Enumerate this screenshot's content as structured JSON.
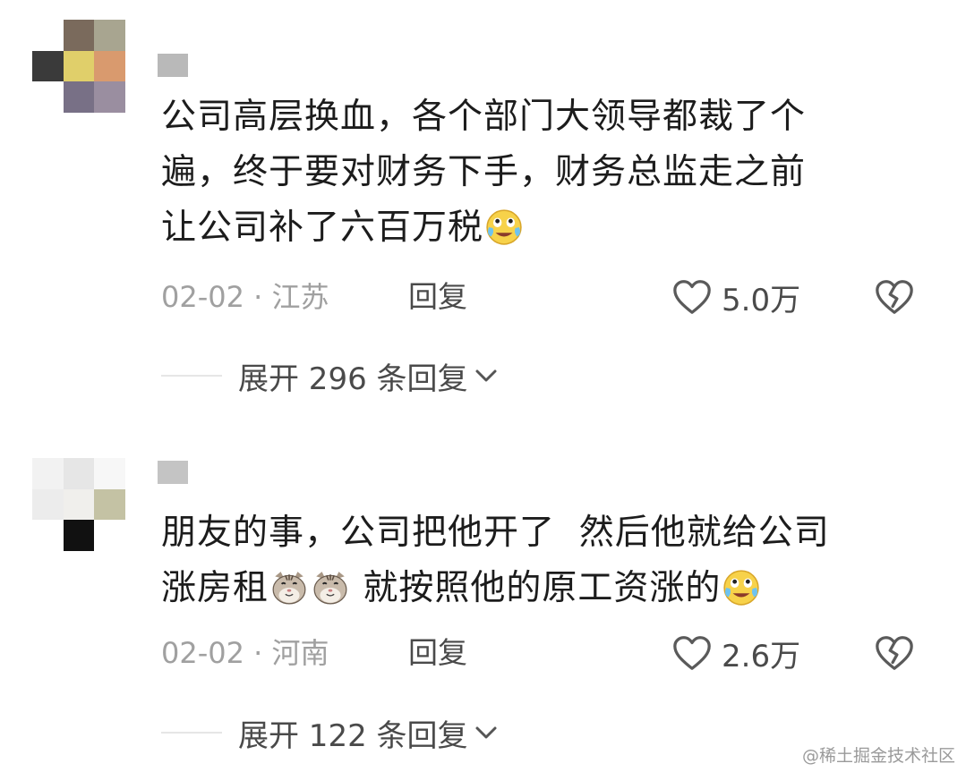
{
  "comments": [
    {
      "text_parts": [
        "公司高层换血，各个部门大领导都裁了个\n遍，终于要对财务下手，财务总监走之前\n让公司补了六百万税"
      ],
      "emojis_after": [
        "crying-laughing-emoji"
      ],
      "date": "02-02",
      "location": "江苏",
      "reply_label": "回复",
      "likes": "5.0万",
      "expand_label": "展开 296 条回复",
      "avatar_colors": [
        "#ffffff",
        "#7a6a5c",
        "#a8a590",
        "#3a3a3a",
        "#e0cf6a",
        "#d99a6e",
        "#ffffff",
        "#787086",
        "#9a8ea0"
      ]
    },
    {
      "line1": "朋友的事，公司把他开了  然后他就给公司",
      "line2_a": "涨房租",
      "line2_b": " 就按照他的原工资涨的",
      "emojis_mid": [
        "cat-face-emoji",
        "cat-face-emoji"
      ],
      "emojis_after": [
        "crying-laughing-emoji"
      ],
      "date": "02-02",
      "location": "河南",
      "reply_label": "回复",
      "likes": "2.6万",
      "expand_label": "展开 122 条回复",
      "avatar_colors": [
        "#f2f2f2",
        "#e6e6e6",
        "#f7f7f7",
        "#ececec",
        "#f0efec",
        "#c4c2a4",
        "#ffffff",
        "#111111",
        "#ffffff"
      ]
    }
  ],
  "meta_separator": "·",
  "watermark": "@稀土掘金技术社区",
  "colors": {
    "text": "#1c1c1c",
    "meta": "#a0a0a0",
    "action": "#4a4a4a"
  }
}
